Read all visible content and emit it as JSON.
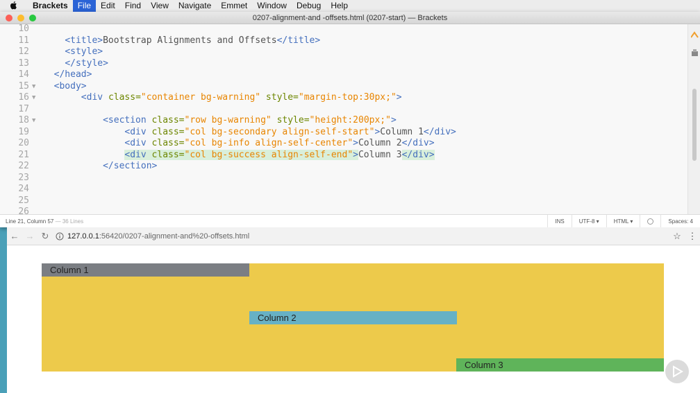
{
  "menubar": {
    "app_name": "Brackets",
    "items": [
      "File",
      "Edit",
      "Find",
      "View",
      "Navigate",
      "Emmet",
      "Window",
      "Debug",
      "Help"
    ],
    "active_item": "File"
  },
  "editor": {
    "window_title": "0207-alignment-and -offsets.html (0207-start) — Brackets",
    "lines": [
      {
        "num": "10",
        "fold": false,
        "segments": []
      },
      {
        "num": "11",
        "fold": false,
        "segments": [
          [
            "",
            "    "
          ],
          [
            "tag",
            "<title>"
          ],
          [
            "txt",
            "Bootstrap Alignments and Offsets"
          ],
          [
            "tag",
            "</title>"
          ]
        ]
      },
      {
        "num": "12",
        "fold": false,
        "segments": [
          [
            "",
            "    "
          ],
          [
            "tag",
            "<style>"
          ]
        ]
      },
      {
        "num": "13",
        "fold": false,
        "segments": [
          [
            "",
            "    "
          ],
          [
            "tag",
            "</style>"
          ]
        ]
      },
      {
        "num": "14",
        "fold": false,
        "segments": [
          [
            "",
            "  "
          ],
          [
            "tag",
            "</head>"
          ]
        ]
      },
      {
        "num": "15",
        "fold": true,
        "segments": [
          [
            "",
            "  "
          ],
          [
            "tag",
            "<body>"
          ]
        ]
      },
      {
        "num": "16",
        "fold": true,
        "segments": [
          [
            "",
            "       "
          ],
          [
            "tag",
            "<div "
          ],
          [
            "attr",
            "class="
          ],
          [
            "val",
            "\"container bg-warning\""
          ],
          [
            "attr",
            " style="
          ],
          [
            "val",
            "\"margin-top:30px;\""
          ],
          [
            "tag",
            ">"
          ]
        ]
      },
      {
        "num": "17",
        "fold": false,
        "segments": []
      },
      {
        "num": "18",
        "fold": true,
        "segments": [
          [
            "",
            "           "
          ],
          [
            "tag",
            "<section "
          ],
          [
            "attr",
            "class="
          ],
          [
            "val",
            "\"row bg-warning\""
          ],
          [
            "attr",
            " style="
          ],
          [
            "val",
            "\"height:200px;\""
          ],
          [
            "tag",
            ">"
          ]
        ]
      },
      {
        "num": "19",
        "fold": false,
        "segments": [
          [
            "",
            "               "
          ],
          [
            "tag",
            "<div "
          ],
          [
            "attr",
            "class="
          ],
          [
            "val",
            "\"col bg-secondary align-self-start\""
          ],
          [
            "tag",
            ">"
          ],
          [
            "txt",
            "Column 1"
          ],
          [
            "tag",
            "</div>"
          ]
        ]
      },
      {
        "num": "20",
        "fold": false,
        "segments": [
          [
            "",
            "               "
          ],
          [
            "tag",
            "<div "
          ],
          [
            "attr",
            "class="
          ],
          [
            "val",
            "\"col bg-info align-self-center\""
          ],
          [
            "tag",
            ">"
          ],
          [
            "txt",
            "Column 2"
          ],
          [
            "tag",
            "</div>"
          ]
        ]
      },
      {
        "num": "21",
        "fold": false,
        "highlight": true,
        "segments": [
          [
            "",
            "               "
          ],
          [
            "tag hl",
            "<div "
          ],
          [
            "attr hl",
            "class="
          ],
          [
            "val hl",
            "\"col bg-success align-self-end\""
          ],
          [
            "tag hl",
            ">"
          ],
          [
            "txt",
            "Column 3"
          ],
          [
            "tag hl",
            "</div>"
          ]
        ]
      },
      {
        "num": "22",
        "fold": false,
        "segments": [
          [
            "",
            "           "
          ],
          [
            "tag",
            "</section>"
          ]
        ]
      },
      {
        "num": "23",
        "fold": false,
        "segments": []
      },
      {
        "num": "24",
        "fold": false,
        "segments": []
      },
      {
        "num": "25",
        "fold": false,
        "segments": []
      },
      {
        "num": "26",
        "fold": false,
        "segments": []
      }
    ]
  },
  "statusbar": {
    "position": "Line 21, Column 57",
    "lines_count": "— 36 Lines",
    "mode": "INS",
    "encoding": "UTF-8",
    "language": "HTML",
    "spaces": "Spaces: 4"
  },
  "browser": {
    "url_host": "127.0.0.1",
    "url_path": ":56420/0207-alignment-and%20-offsets.html"
  },
  "page": {
    "columns": [
      "Column 1",
      "Column 2",
      "Column 3"
    ],
    "colors": {
      "warning": "#edca4b",
      "secondary": "#7b7e83",
      "info": "#67b1c5",
      "success": "#5fb45a"
    }
  }
}
